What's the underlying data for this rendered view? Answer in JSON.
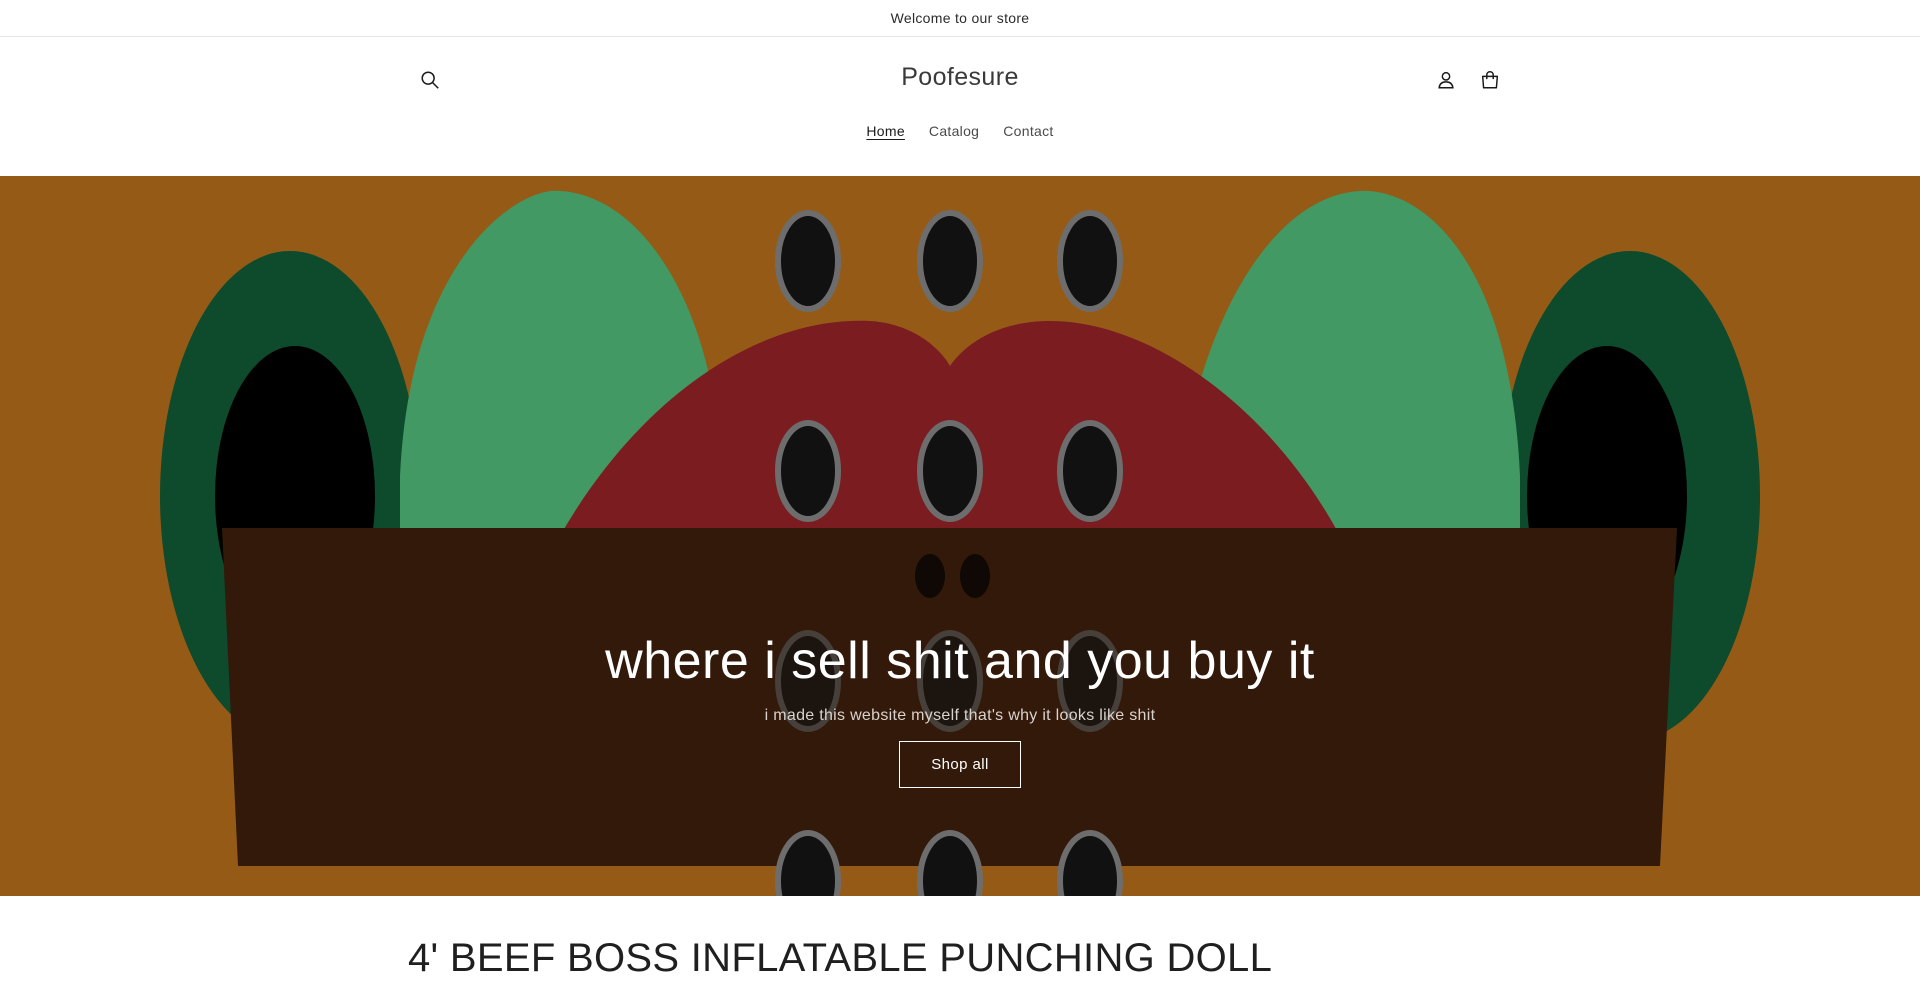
{
  "announcement": {
    "text": "Welcome to our store"
  },
  "header": {
    "brand": "Poofesure",
    "icons": {
      "search": "search-icon",
      "account": "account-icon",
      "cart": "cart-icon"
    },
    "nav": [
      {
        "label": "Home",
        "active": true
      },
      {
        "label": "Catalog",
        "active": false
      },
      {
        "label": "Contact",
        "active": false
      }
    ]
  },
  "hero": {
    "title": "where i sell shit and you buy it",
    "subtitle": "i made this website myself that's why it looks like shit",
    "button_label": "Shop all",
    "colors": {
      "background": "#955b16",
      "box": "#33190a",
      "red": "#7b1c21",
      "green_light": "#429964",
      "green_dark": "#0e4a2c"
    }
  },
  "product": {
    "title": "4' BEEF BOSS INFLATABLE PUNCHING DOLL"
  }
}
